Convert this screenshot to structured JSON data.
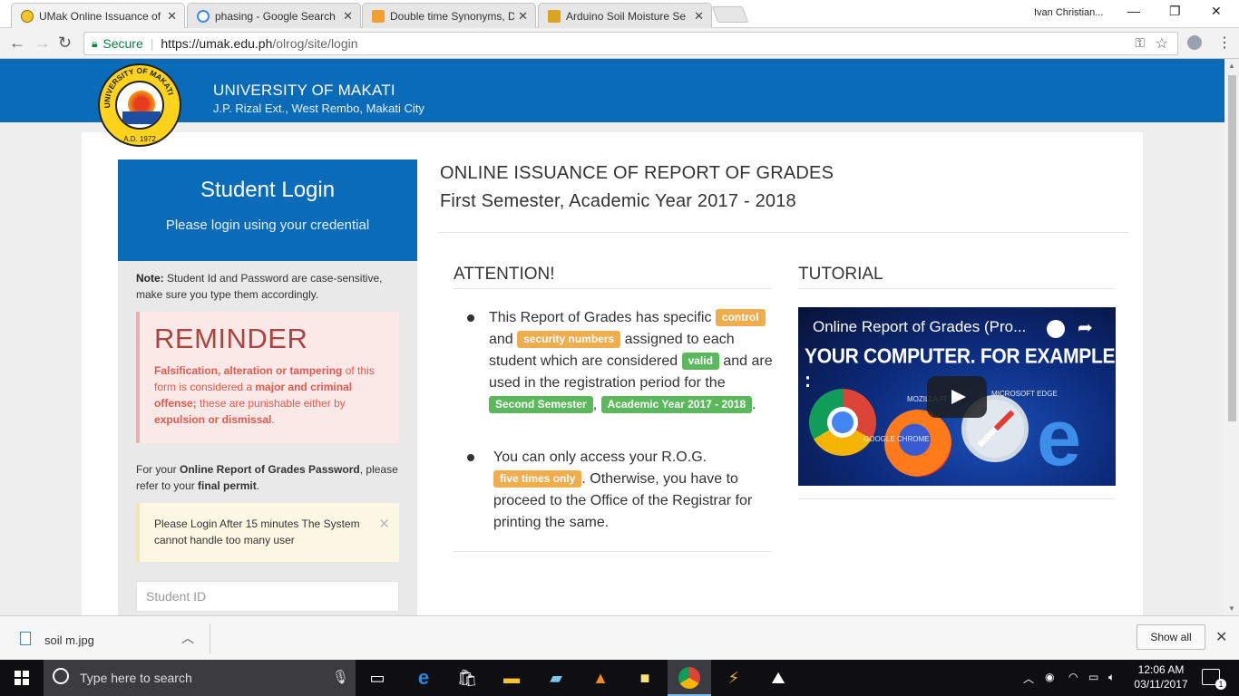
{
  "browser": {
    "tabs": [
      {
        "title": "UMak Online Issuance of",
        "active": true
      },
      {
        "title": "phasing - Google Search"
      },
      {
        "title": "Double time Synonyms, D"
      },
      {
        "title": "Arduino Soil Moisture Se"
      }
    ],
    "close_glyph": "✕",
    "profile_name": "Ivan Christian...",
    "secure_label": "Secure",
    "url_host": "https://umak.edu.ph",
    "url_path": "/olrog/site/login"
  },
  "header": {
    "university": "UNIVERSITY OF MAKATI",
    "address": "J.P. Rizal Ext., West Rembo, Makati City",
    "seal_text": "UNIVERSITY OF MAKATI",
    "seal_year": "A.D. 1972",
    "brand_color": "#0a6cb8"
  },
  "login": {
    "title": "Student Login",
    "subtitle": "Please login using your credential",
    "note_label": "Note:",
    "note_text": " Student Id and Password are case-sensitive, make sure you type them accordingly.",
    "reminder_title": "REMINDER",
    "reminder_strong1": "Falsification, alteration or tampering",
    "reminder_t1": " of this form is considered a ",
    "reminder_strong2": "major and criminal offense;",
    "reminder_t2": " these are punishable either by ",
    "reminder_strong3": "expulsion or dismissal",
    "reminder_t3": ".",
    "pw_t1": "For your ",
    "pw_strong1": "Online Report of Grades Password",
    "pw_t2": ", please refer to your ",
    "pw_strong2": "final permit",
    "pw_t3": ".",
    "warning_text": "Please Login After 15 minutes The System cannot handle too many user",
    "warning_close": "✕",
    "student_id_placeholder": "Student ID"
  },
  "content": {
    "title_line1": "ONLINE ISSUANCE OF REPORT OF GRADES",
    "title_line2": "First Semester, Academic Year 2017 - 2018",
    "attention_heading": "ATTENTION!",
    "tutorial_heading": "TUTORIAL",
    "b1_t1": "This Report of Grades has specific ",
    "b1_badge_control": "control",
    "b1_t2": " and ",
    "b1_badge_security": "security numbers",
    "b1_t3": " assigned to each student which are considered ",
    "b1_badge_valid": "valid",
    "b1_t4": " and are used in the registration period for the ",
    "b1_badge_semester": "Second Semester",
    "b1_t5": ", ",
    "b1_badge_year": "Academic Year 2017 - 2018",
    "b1_t6": ".",
    "b2_t1": "You can only access your R.O.G. ",
    "b2_badge_times": "five times only",
    "b2_t2": ". Otherwise, you have to proceed to the Office of the Registrar for printing the same.",
    "video_title": "Online Report of Grades (Pro...",
    "video_overlay_text": "YOUR COMPUTER. FOR EXAMPLE :",
    "video_label_chrome": "GOOGLE CHROME",
    "video_label_mozilla": "MOZILLA FI",
    "video_label_safari": "SAFARI",
    "video_label_edge": "MICROSOFT EDGE",
    "badge_orange": "#f0ad4e",
    "badge_green": "#5cb85c"
  },
  "downloads": {
    "file_name": "soil m.jpg",
    "show_all_label": "Show all"
  },
  "taskbar": {
    "search_placeholder": "Type here to search",
    "time": "12:06 AM",
    "date": "03/11/2017",
    "notification_count": "1"
  }
}
